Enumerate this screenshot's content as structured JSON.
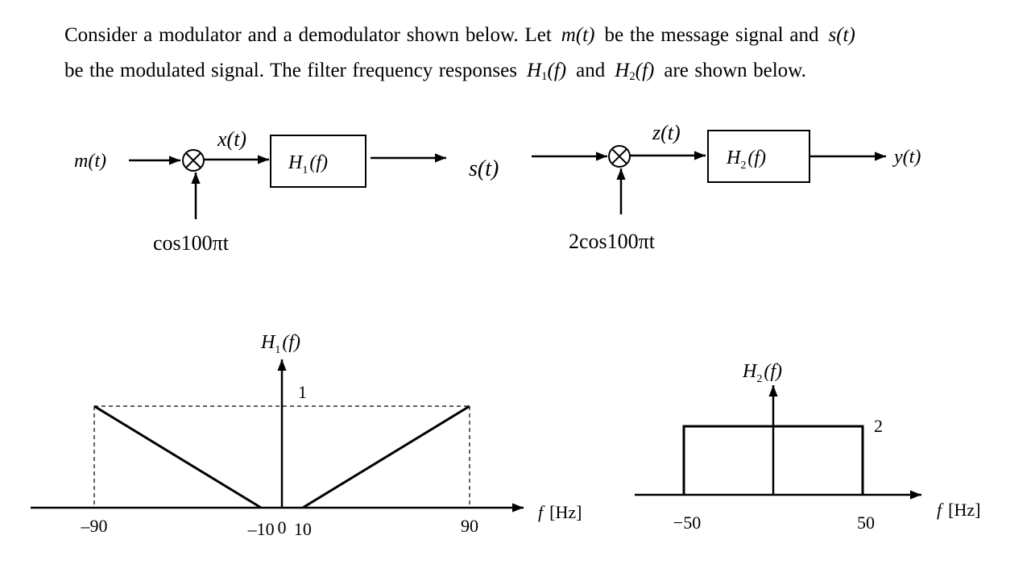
{
  "problem": {
    "line1": {
      "t1": "Consider a modulator and a demodulator shown below. Let",
      "v1": "m(t)",
      "t2": "be the message signal and",
      "v2": "s(t)"
    },
    "line2": {
      "t1": "be the modulated signal. The filter frequency responses",
      "v1_main": "H",
      "v1_sub": "1",
      "v1_arg": "(f)",
      "t2": "and",
      "v2_main": "H",
      "v2_sub": "2",
      "v2_arg": "(f)",
      "t3": "are shown below."
    }
  },
  "modulator": {
    "input_label": "m(t)",
    "mixer_symbol": "⊗",
    "carrier_label": "cos100πt",
    "mixer_output_label": "x(t)",
    "filter_main": "H",
    "filter_sub": "1",
    "filter_arg": "(f)",
    "output_label": "s(t)"
  },
  "demodulator": {
    "mixer_symbol": "⊗",
    "carrier_label": "2cos100πt",
    "mixer_output_label": "z(t)",
    "filter_main": "H",
    "filter_sub": "2",
    "filter_arg": "(f)",
    "output_label": "y(t)"
  },
  "chart_data": [
    {
      "type": "line",
      "title_main": "H",
      "title_sub": "1",
      "title_arg": "(f)",
      "xlabel_var": "f",
      "xlabel_unit": "[Hz]",
      "xlim": [
        -100,
        100
      ],
      "ylim": [
        0,
        1.2
      ],
      "peak_label": "1",
      "segments": [
        {
          "x": [
            -90,
            -10
          ],
          "y": [
            1,
            0
          ]
        },
        {
          "x": [
            10,
            90
          ],
          "y": [
            0,
            1
          ]
        }
      ],
      "guides": {
        "level": 1,
        "x": [
          -90,
          90
        ],
        "style": "dashed"
      },
      "tick_labels": [
        "–90",
        "–10",
        "0",
        "10",
        "90"
      ],
      "tick_values": [
        -90,
        -10,
        0,
        10,
        90
      ]
    },
    {
      "type": "line",
      "title_main": "H",
      "title_sub": "2",
      "title_arg": "(f)",
      "xlabel_var": "f",
      "xlabel_unit": "[Hz]",
      "xlim": [
        -60,
        60
      ],
      "ylim": [
        0,
        2.5
      ],
      "level_label": "2",
      "segments": [
        {
          "x": [
            -50,
            -50,
            50,
            50
          ],
          "y": [
            0,
            2,
            2,
            0
          ]
        }
      ],
      "tick_labels": [
        "−50",
        "50"
      ],
      "tick_values": [
        -50,
        50
      ]
    }
  ]
}
